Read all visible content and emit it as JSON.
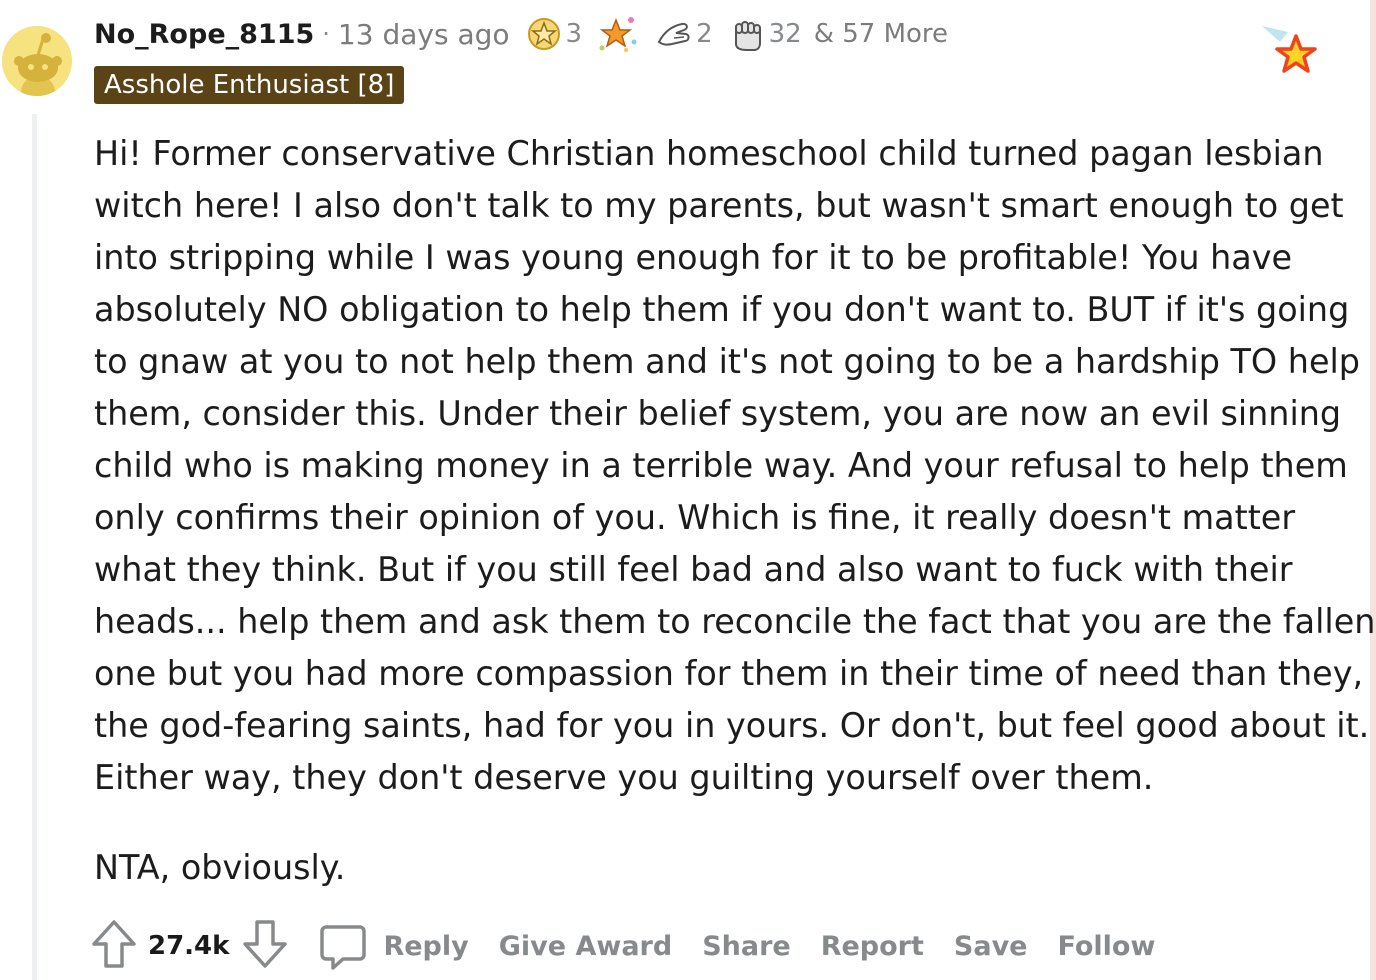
{
  "comment": {
    "author": "No_Rope_8115",
    "separator": "·",
    "timestamp": "13 days ago",
    "awards": [
      {
        "icon": "star-award-icon",
        "count": "3"
      },
      {
        "icon": "sparkle-award-icon",
        "count": ""
      },
      {
        "icon": "hand-award-icon",
        "count": "2"
      },
      {
        "icon": "fist-award-icon",
        "count": "32"
      }
    ],
    "more_awards": "& 57 More",
    "flair": "Asshole Enthusiast [8]",
    "paragraphs": [
      "Hi! Former conservative Christian homeschool child turned pagan lesbian witch here! I also don't talk to my parents, but wasn't smart enough to get into stripping while I was young enough for it to be profitable! You have absolutely NO obligation to help them if you don't want to. BUT if it's going to gnaw at you to not help them and it's not going to be a hardship TO help them, consider this. Under their belief system, you are now an evil sinning child who is making money in a terrible way. And your refusal to help them only confirms their opinion of you. Which is fine, it really doesn't matter what they think. But if you still feel bad and also want to fuck with their heads... help them and ask them to reconcile the fact that you are the fallen one but you had more compassion for them in their time of need than they, the god-fearing saints, had for you in yours. Or don't, but feel good about it. Either way, they don't deserve you guilting yourself over them.",
      "NTA, obviously."
    ],
    "votes": "27.4k",
    "actions": {
      "reply": "Reply",
      "give_award": "Give Award",
      "share": "Share",
      "report": "Report",
      "save": "Save",
      "follow": "Follow"
    }
  },
  "colors": {
    "flair_bg": "#5b4318",
    "meta_gray": "#878a8c",
    "thread_line": "#edeff1",
    "avatar_yellow": "#f6e27f"
  }
}
